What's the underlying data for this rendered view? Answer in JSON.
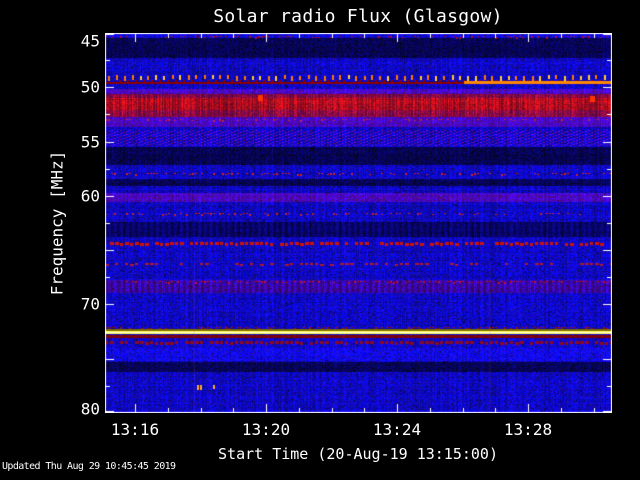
{
  "window": {
    "bg": "#000000",
    "fg": "#ffffff"
  },
  "footer": {
    "updated": "Updated Thu Aug 29 10:45:45 2019"
  },
  "chart_data": {
    "type": "heatmap",
    "title": "Solar radio Flux (Glasgow)",
    "xlabel": "Start Time (20-Aug-19 13:15:00)",
    "ylabel": "Frequency [MHz]",
    "x_axis": {
      "start_date": "20-Aug-19",
      "start_time": "13:15:00",
      "domain_minutes": [
        0.08,
        15.56
      ],
      "labeled_ticks": [
        {
          "t": 1,
          "label": "13:16"
        },
        {
          "t": 5,
          "label": "13:20"
        },
        {
          "t": 9,
          "label": "13:24"
        },
        {
          "t": 13,
          "label": "13:28"
        }
      ],
      "minor_tick_minutes": [
        0,
        1,
        2,
        3,
        4,
        5,
        6,
        7,
        8,
        9,
        10,
        11,
        12,
        13,
        14,
        15
      ]
    },
    "y_axis": {
      "unit": "MHz",
      "range": [
        45,
        80
      ],
      "inverted": true,
      "labeled_ticks": [
        {
          "value": 45,
          "label": "45"
        },
        {
          "value": 50,
          "label": "50"
        },
        {
          "value": 55,
          "label": "55"
        },
        {
          "value": 60,
          "label": "60"
        },
        {
          "value": 70,
          "label": "70"
        },
        {
          "value": 80,
          "label": "80"
        }
      ],
      "major_ticks": [
        45,
        50,
        55,
        60,
        65,
        70,
        75,
        80
      ],
      "minor_ticks": [
        47.5,
        52.5,
        57.5,
        62.5,
        67.5,
        72.5,
        77.5
      ]
    },
    "palette": {
      "background_noise": "#1616d9",
      "dark_band": "#000060",
      "purple_band": "#50109a",
      "emission_band_red": "#a81200",
      "interference_yellow": "#ffff55",
      "interference_white": "#ffffd8",
      "maroon": "#7a0010",
      "dotted_rfi_orange": "#ff7700",
      "dotted_rfi_bright": "#ffcc33"
    },
    "bands": [
      {
        "type": "bright",
        "f0": 45.0,
        "f1": 45.35
      },
      {
        "type": "dark",
        "f0": 45.45,
        "f1": 47.3
      },
      {
        "type": "purple",
        "f0": 50.15,
        "f1": 50.6
      },
      {
        "type": "red_soft",
        "f0": 50.6,
        "f1": 52.7
      },
      {
        "type": "red_strong",
        "f0": 51.0,
        "f1": 52.1
      },
      {
        "type": "purple",
        "f0": 52.72,
        "f1": 53.65
      },
      {
        "type": "hatch",
        "f0": 53.95,
        "f1": 55.4
      },
      {
        "type": "dark",
        "f0": 55.5,
        "f1": 57.2
      },
      {
        "type": "dark",
        "f0": 58.45,
        "f1": 59.1
      },
      {
        "type": "purple",
        "f0": 59.75,
        "f1": 60.55
      },
      {
        "type": "dark_cols",
        "f0": 62.4,
        "f1": 63.8
      },
      {
        "type": "purple_cols",
        "f0": 67.75,
        "f1": 68.95
      },
      {
        "type": "bright",
        "f0": 74.0,
        "f1": 75.2
      },
      {
        "type": "dark",
        "f0": 75.3,
        "f1": 76.2
      },
      {
        "type": "bright",
        "f0": 79.72,
        "f1": 80.0
      }
    ],
    "features": [
      {
        "type": "speckle_line",
        "f": 45.3,
        "color": "#aa1133",
        "density": 0.45
      },
      {
        "type": "dash_row",
        "f": 48.85,
        "period": 8,
        "color": "#ff7700",
        "bright": "#ffcc33"
      },
      {
        "type": "line",
        "f": 49.5,
        "h": 2,
        "color": "#8b0000"
      },
      {
        "type": "segment",
        "f": 49.45,
        "t0": 11.05,
        "t1": 15.6,
        "h": 3,
        "color": "#ff8800"
      },
      {
        "type": "blip",
        "t": 4.76,
        "f": 50.7,
        "w": 5,
        "h": 6,
        "color": "#ff3300"
      },
      {
        "type": "blip",
        "t": 14.9,
        "f": 50.8,
        "w": 5,
        "h": 6,
        "color": "#ff3300"
      },
      {
        "type": "speckle_line",
        "f": 52.9,
        "color": "#bb2244",
        "density": 0.35
      },
      {
        "type": "speckle_line",
        "f": 57.9,
        "color": "#cc2233",
        "density": 0.4
      },
      {
        "type": "speckle_line",
        "f": 61.6,
        "color": "#bb2233",
        "density": 0.35
      },
      {
        "type": "dash_line",
        "f": 64.25,
        "h": 3,
        "color": "#cc1405",
        "density": 0.8
      },
      {
        "type": "dash_line",
        "f": 66.2,
        "h": 2,
        "color": "#aa1a33",
        "density": 0.5
      },
      {
        "type": "speckle_line",
        "f": 67.85,
        "color": "#bb1133",
        "density": 0.45
      },
      {
        "type": "speckle_line",
        "f": 72.1,
        "color": "#991108",
        "density": 0.5
      },
      {
        "type": "line",
        "f": 72.28,
        "h": 2,
        "color": "#7d6b00"
      },
      {
        "type": "line",
        "f": 72.46,
        "h": 3,
        "color": "#ffff55"
      },
      {
        "type": "line",
        "f": 72.55,
        "h": 1,
        "color": "#ffffd8"
      },
      {
        "type": "line",
        "f": 72.84,
        "h": 3,
        "color": "#7a0010"
      },
      {
        "type": "dash_line",
        "f": 73.4,
        "h": 3,
        "color": "#8b0a20",
        "density": 0.85
      },
      {
        "type": "speck",
        "t": 2.9,
        "f": 77.45,
        "w": 2,
        "h": 5,
        "color": "#ffaa22"
      },
      {
        "type": "speck",
        "t": 2.99,
        "f": 77.45,
        "w": 2,
        "h": 5,
        "color": "#ffaa22"
      },
      {
        "type": "speck",
        "t": 3.39,
        "f": 77.45,
        "w": 2,
        "h": 4,
        "color": "#ffaa22"
      },
      {
        "type": "v_streak",
        "t": 2.77,
        "f0": 66.0,
        "color": "#9944aa",
        "alpha": 0.1
      },
      {
        "type": "v_streak",
        "t": 11.82,
        "f0": 66.0,
        "color": "#9944aa",
        "alpha": 0.1
      }
    ]
  }
}
